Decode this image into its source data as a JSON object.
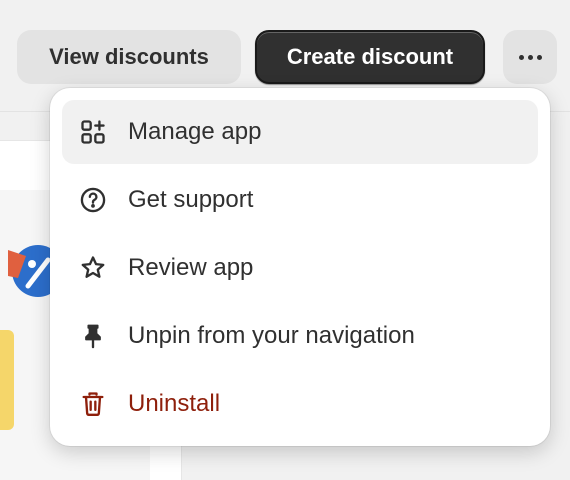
{
  "header": {
    "view_discounts_label": "View discounts",
    "create_discount_label": "Create discount",
    "more_actions_icon": "ellipsis-horizontal-icon"
  },
  "menu": {
    "items": [
      {
        "label": "Manage app",
        "icon": "apps-add-icon",
        "state": "hovered"
      },
      {
        "label": "Get support",
        "icon": "question-circle-icon"
      },
      {
        "label": "Review app",
        "icon": "star-icon"
      },
      {
        "label": "Unpin from your navigation",
        "icon": "pin-icon"
      },
      {
        "label": "Uninstall",
        "icon": "trash-icon",
        "tone": "critical"
      }
    ]
  },
  "colors": {
    "primary_button_bg": "#303030",
    "secondary_button_bg": "#e3e3e3",
    "critical_text": "#8e1f0b",
    "hover_bg": "#f1f1f1",
    "page_bg": "#f1f1f1"
  }
}
